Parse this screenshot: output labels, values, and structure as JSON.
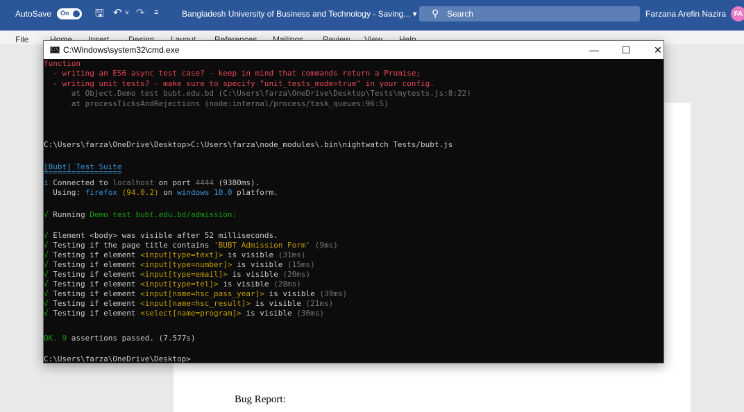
{
  "word": {
    "autosave_label": "AutoSave",
    "autosave_state": "On",
    "doc_title": "Bangladesh University of Business and Technology - Saving... ▾",
    "search_placeholder": "Search",
    "user_name": "Farzana Arefin Nazira",
    "user_initials": "FA",
    "ribbon_tabs": [
      "File",
      "Home",
      "Insert",
      "Design",
      "Layout",
      "References",
      "Mailings",
      "Review",
      "View",
      "Help"
    ],
    "doc_text": "Bug Report:"
  },
  "cmd": {
    "title": "C:\\Windows\\system32\\cmd.exe",
    "icon_text": "C:\\",
    "minimize": "—",
    "maximize": "☐",
    "close": "✕",
    "lines": {
      "l0": "function",
      "l1": "  - writing an ES6 async test case? - keep in mind that commands return a Promise;",
      "l2": "  - writing unit tests? - make sure to specify \"unit_tests_mode=true\" in your config.",
      "l3": "      at Object.Demo test bubt.edu.bd (C:\\Users\\farza\\OneDrive\\Desktop\\Tests\\mytests.js:8:22)",
      "l4": "      at processTicksAndRejections (node:internal/process/task_queues:96:5)",
      "l5": "C:\\Users\\farza\\OneDrive\\Desktop>C:\\Users\\farza\\node_modules\\.bin\\nightwatch Tests/bubt.js",
      "l6": "[Bubt] Test Suite",
      "l7": "=================",
      "l8a": "i",
      "l8b": " Connected to ",
      "l8c": "localhost",
      "l8d": " on port ",
      "l8e": "4444",
      "l8f": " (9380ms).",
      "l9a": "  Using: ",
      "l9b": "firefox",
      "l9c": " (94.0.2)",
      "l9d": " on ",
      "l9e": "windows 10.0",
      "l9f": " platform.",
      "l10a": "√",
      "l10b": " Running ",
      "l10c": "Demo test bubt.edu.bd/admission:",
      "checks": [
        {
          "mark": "√",
          "pre": " Element <body> was visible after 52 milliseconds.",
          "hl": "",
          "post": "",
          "time": ""
        },
        {
          "mark": "√",
          "pre": " Testing if the page title contains ",
          "hl": "'BUBT Admission Form'",
          "post": "",
          "time": " (9ms)"
        },
        {
          "mark": "√",
          "pre": " Testing if element ",
          "hl": "<input[type=text]>",
          "post": " is visible",
          "time": " (31ms)"
        },
        {
          "mark": "√",
          "pre": " Testing if element ",
          "hl": "<input[type=number]>",
          "post": " is visible",
          "time": " (15ms)"
        },
        {
          "mark": "√",
          "pre": " Testing if element ",
          "hl": "<input[type=email]>",
          "post": " is visible",
          "time": " (20ms)"
        },
        {
          "mark": "√",
          "pre": " Testing if element ",
          "hl": "<input[type=tel]>",
          "post": " is visible",
          "time": " (28ms)"
        },
        {
          "mark": "√",
          "pre": " Testing if element ",
          "hl": "<input[name=hsc_pass_year]>",
          "post": " is visible",
          "time": " (39ms)"
        },
        {
          "mark": "√",
          "pre": " Testing if element ",
          "hl": "<input[name=hsc_result]>",
          "post": " is visible",
          "time": " (21ms)"
        },
        {
          "mark": "√",
          "pre": " Testing if element ",
          "hl": "<select[name=program]>",
          "post": " is visible",
          "time": " (36ms)"
        }
      ],
      "ok_a": "OK.",
      "ok_b": " 9",
      "ok_c": " assertions passed. (7.577s)",
      "prompt": "C:\\Users\\farza\\OneDrive\\Desktop>"
    }
  }
}
